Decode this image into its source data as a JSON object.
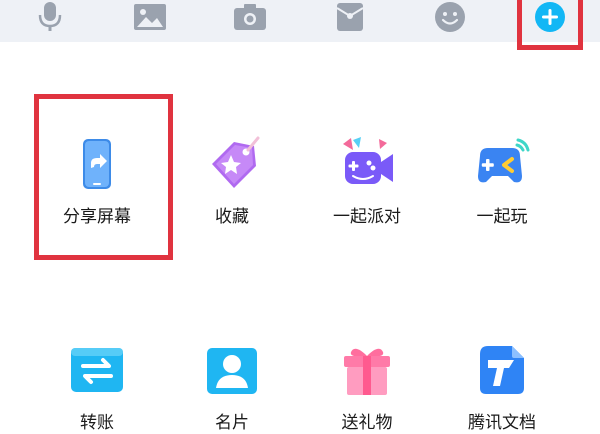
{
  "toolbar": {
    "buttons": [
      {
        "name": "mic-icon"
      },
      {
        "name": "image-icon"
      },
      {
        "name": "camera-icon"
      },
      {
        "name": "red-packet-icon"
      },
      {
        "name": "emoji-icon"
      },
      {
        "name": "plus-icon"
      }
    ],
    "accent": "#12b7f5",
    "icon_color": "#9aa2ae"
  },
  "panel": {
    "items": [
      {
        "label": "分享屏幕",
        "icon": "share-screen-icon"
      },
      {
        "label": "收藏",
        "icon": "favorite-icon"
      },
      {
        "label": "一起派对",
        "icon": "party-icon"
      },
      {
        "label": "一起玩",
        "icon": "game-icon"
      },
      {
        "label": "转账",
        "icon": "transfer-icon"
      },
      {
        "label": "名片",
        "icon": "contact-card-icon"
      },
      {
        "label": "送礼物",
        "icon": "gift-icon"
      },
      {
        "label": "腾讯文档",
        "icon": "tencent-docs-icon"
      }
    ]
  },
  "highlight_color": "#e0333f"
}
